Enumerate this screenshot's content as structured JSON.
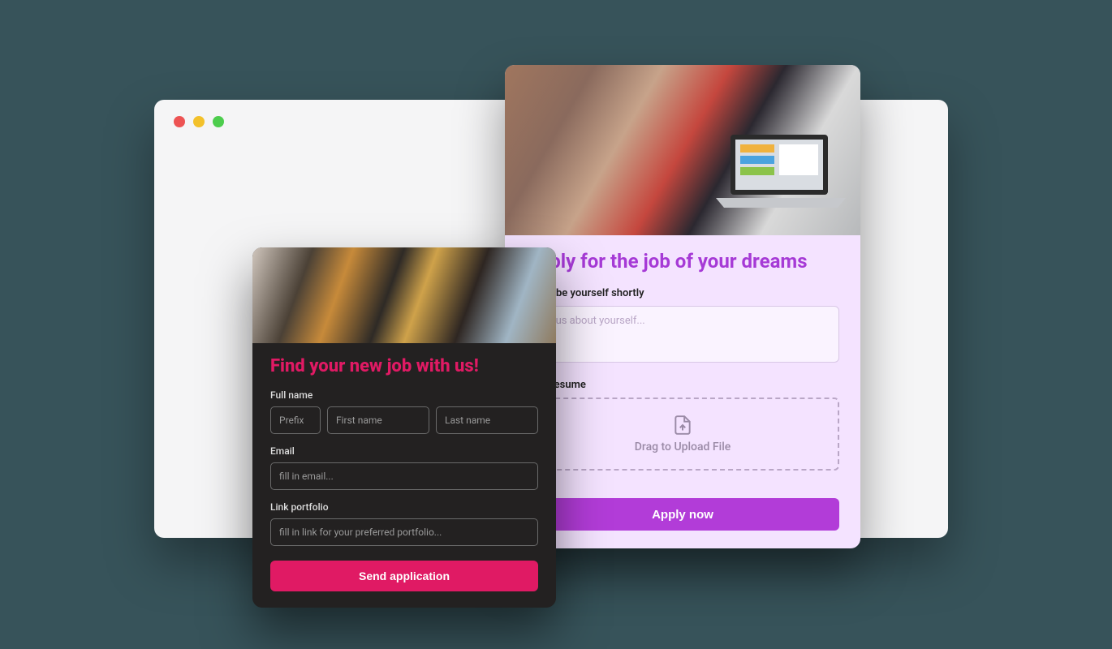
{
  "purple_card": {
    "title": "Apply for the job of your dreams",
    "describe_label": "Describe yourself shortly",
    "describe_placeholder": "Tell us about yourself...",
    "resume_label": "Your resume",
    "upload_text": "Drag to Upload File",
    "submit_label": "Apply now"
  },
  "dark_card": {
    "title": "Find your new job with us!",
    "fullname_label": "Full name",
    "prefix_placeholder": "Prefix",
    "firstname_placeholder": "First name",
    "lastname_placeholder": "Last name",
    "email_label": "Email",
    "email_placeholder": "fill in email...",
    "portfolio_label": "Link portfolio",
    "portfolio_placeholder": "fill in link for your preferred portfolio...",
    "submit_label": "Send application"
  }
}
